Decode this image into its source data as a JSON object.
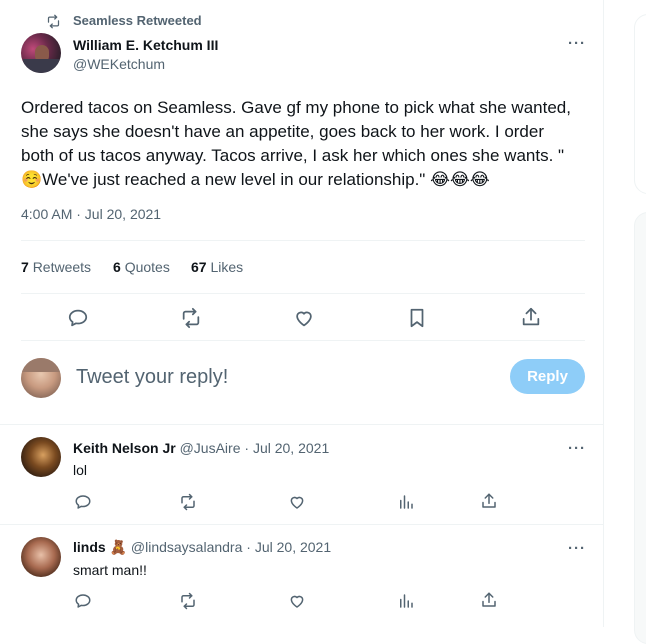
{
  "retweet_context": {
    "text": "Seamless Retweeted"
  },
  "tweet": {
    "author_name": "William E. Ketchum III",
    "author_handle": "@WEKetchum",
    "text_line1": "Ordered tacos on Seamless. Gave gf my phone to pick what she wanted,",
    "text_line2": "she says she doesn't have an appetite, goes back to her work. I order",
    "text_line3": "both of us tacos anyway. Tacos arrive, I ask her which ones she wants. \"",
    "text_line4_emoji_start": "☺️",
    "text_line4": "We've just reached a new level in our relationship.\"",
    "text_line4_emoji_end": "😂😂😂",
    "timestamp": "4:00 AM · Jul 20, 2021",
    "stats": [
      {
        "count": "7",
        "label": "Retweets"
      },
      {
        "count": "6",
        "label": "Quotes"
      },
      {
        "count": "67",
        "label": "Likes"
      }
    ],
    "more_label": "···"
  },
  "reply_box": {
    "placeholder": "Tweet your reply!",
    "button_label": "Reply"
  },
  "replies": [
    {
      "name": "Keith Nelson Jr",
      "name_emoji": "",
      "handle": "@JusAire",
      "date": "· Jul 20, 2021",
      "text": "lol"
    },
    {
      "name": "linds",
      "name_emoji": "🧸",
      "handle": "@lindsaysalandra",
      "date": "· Jul 20, 2021",
      "text": "smart man!!"
    }
  ],
  "colors": {
    "accent": "#1d9bf0",
    "reply_button_disabled": "#8ecdf8",
    "text_primary": "#0f1419",
    "text_secondary": "#536471",
    "border": "#eff3f4"
  }
}
